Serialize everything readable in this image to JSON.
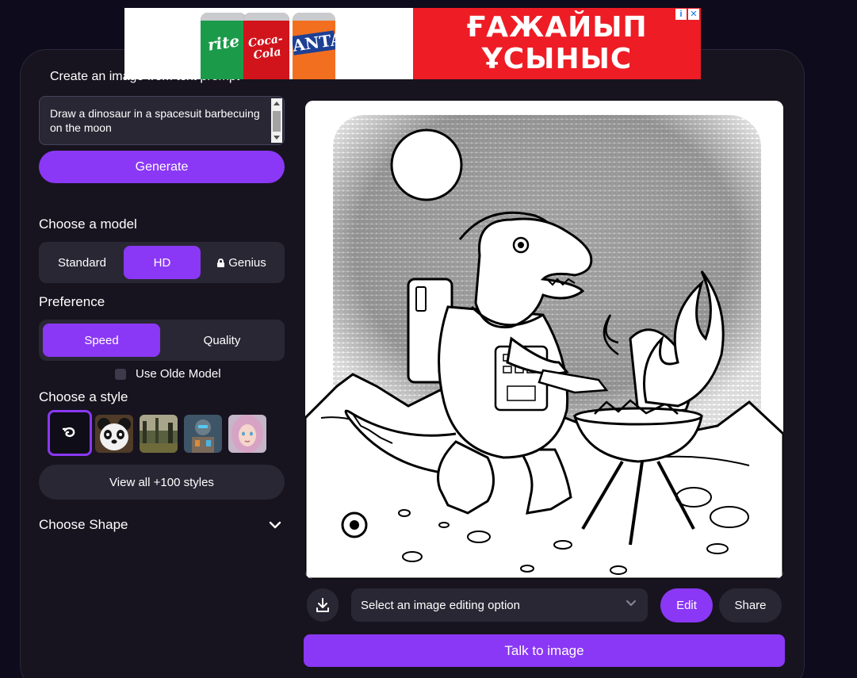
{
  "ad": {
    "headline_line1": "ҒАЖАЙЫП",
    "headline_line2": "ҰСЫНЫС",
    "brand_can_1": "rite",
    "brand_can_2": "Coca-Cola",
    "brand_can_3": "ANTA",
    "info_badge": "i",
    "close_badge": "✕",
    "colors": {
      "banner_red": "#ee1c25"
    }
  },
  "sidebar": {
    "title": "Create an image from text prompt",
    "prompt_value": "Draw a dinosaur in a spacesuit barbecuing on the moon",
    "generate_label": "Generate",
    "model_heading": "Choose a model",
    "models": [
      {
        "label": "Standard",
        "active": false
      },
      {
        "label": "HD",
        "active": true
      },
      {
        "label": "Genius",
        "active": false,
        "locked": true
      }
    ],
    "preference_heading": "Preference",
    "preferences": [
      {
        "label": "Speed",
        "active": true
      },
      {
        "label": "Quality",
        "active": false
      }
    ],
    "old_model_label": "Use Olde Model",
    "style_heading": "Choose a style",
    "styles": [
      "none",
      "panda",
      "forest",
      "robot",
      "portrait"
    ],
    "view_all_label": "View all +100 styles",
    "shape_heading": "Choose Shape"
  },
  "main": {
    "image_alt": "Line-art coloring page of a dinosaur in a spacesuit barbecuing on the moon",
    "edit_placeholder": "Select an image editing option",
    "edit_label": "Edit",
    "share_label": "Share",
    "talk_label": "Talk to image"
  },
  "colors": {
    "accent": "#8a38f5",
    "panel": "#17141f",
    "control_bg": "#2a2735",
    "page_bg": "#0e0b1c"
  }
}
